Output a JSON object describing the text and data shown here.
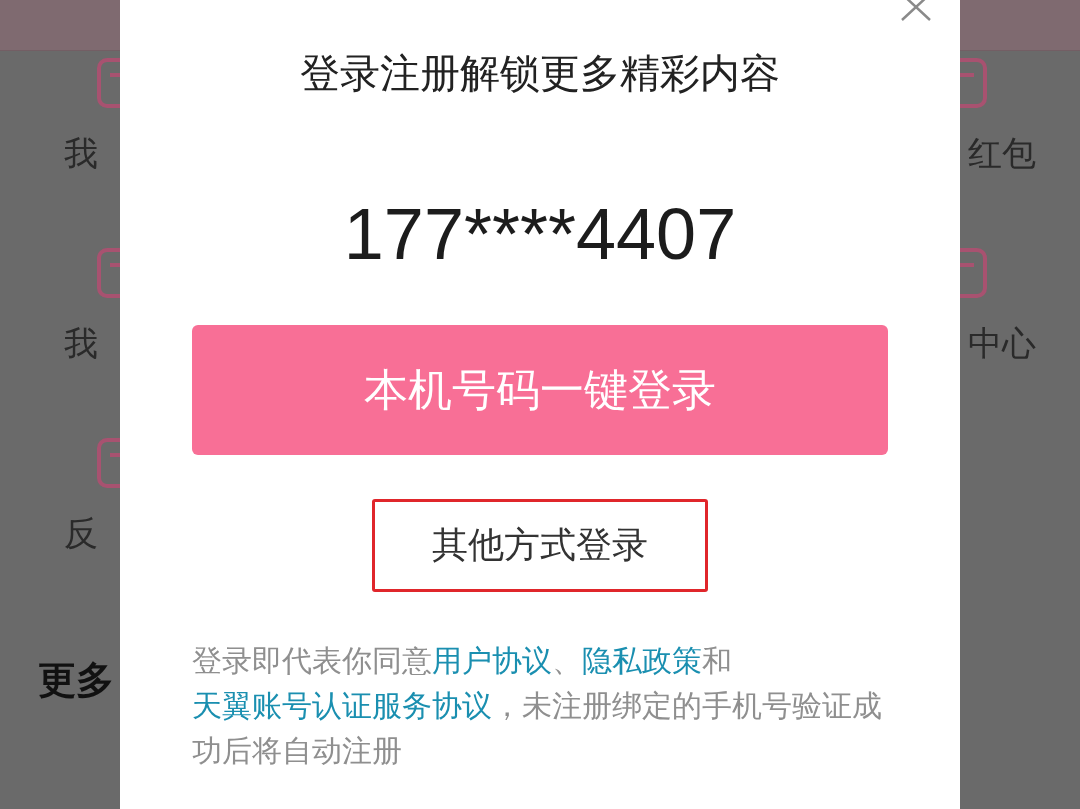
{
  "background_left": {
    "items": [
      {
        "label": "我"
      },
      {
        "label": "我"
      },
      {
        "label": "反"
      }
    ],
    "section_title": "更多"
  },
  "background_right": {
    "items": [
      {
        "label": "红包"
      },
      {
        "label": "中心"
      }
    ]
  },
  "dialog": {
    "title": "登录注册解锁更多精彩内容",
    "phone_number": "177****4407",
    "primary_button": "本机号码一键登录",
    "other_login": {
      "label": "其他方式登录",
      "highlighted": true
    },
    "agreement": [
      {
        "kind": "plain",
        "text": "登录即代表你同意"
      },
      {
        "kind": "link",
        "text": "用户协议"
      },
      {
        "kind": "plain",
        "text": "、"
      },
      {
        "kind": "link",
        "text": "隐私政策"
      },
      {
        "kind": "plain",
        "text": "和"
      },
      {
        "kind": "link",
        "text": "天翼账号认证服务协议"
      },
      {
        "kind": "plain",
        "text": "，未注册绑定的手机号验证成功后将自动注册"
      }
    ]
  }
}
